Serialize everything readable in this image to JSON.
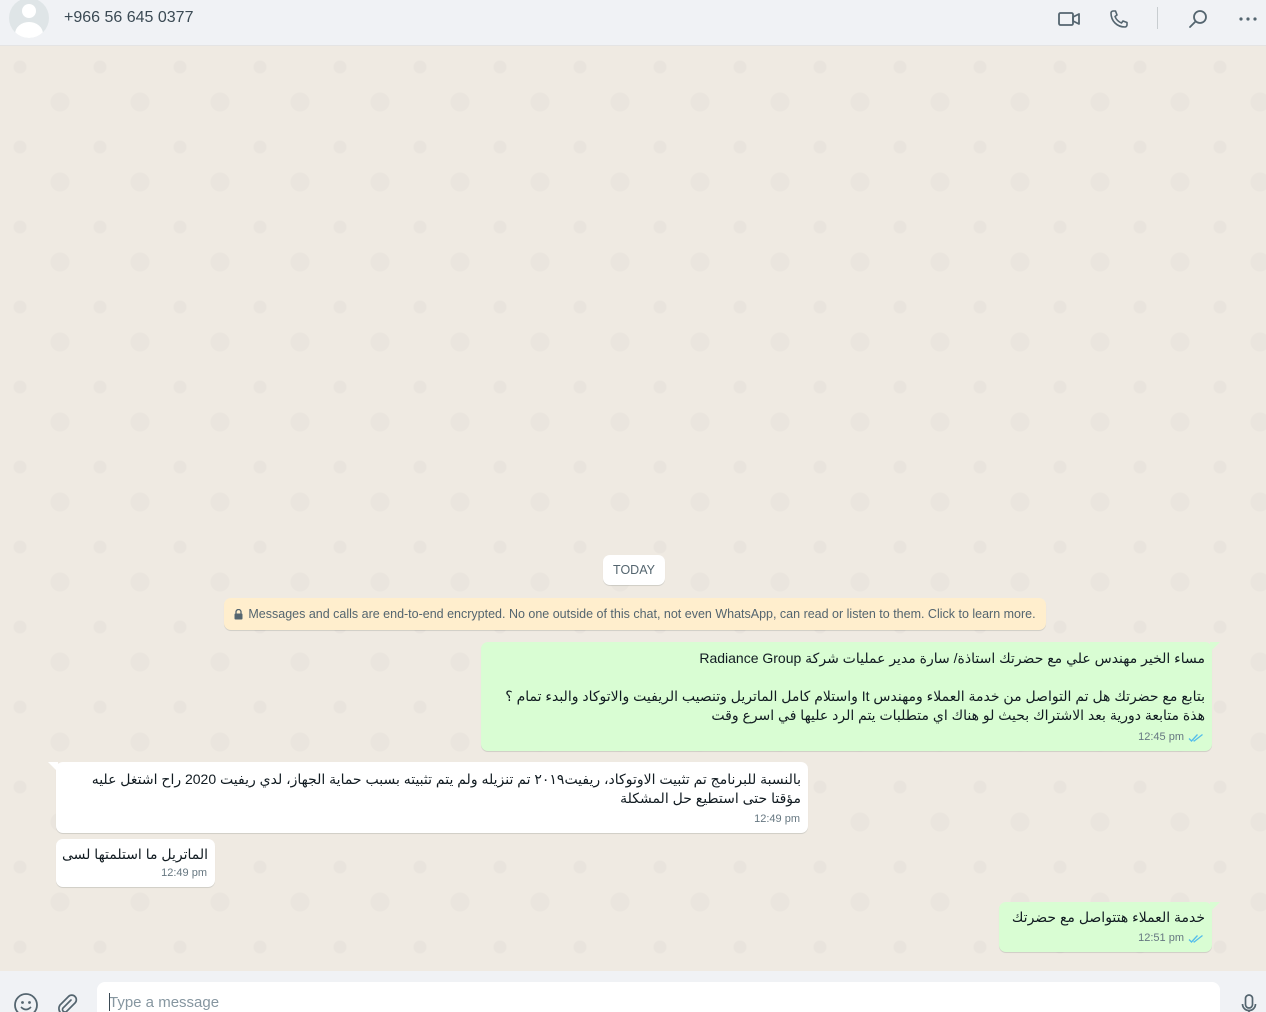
{
  "header": {
    "contact_name": "+966 56 645 0377",
    "icons": [
      "avatar",
      "video-call-icon",
      "voice-call-icon",
      "search-icon",
      "more-menu-icon"
    ]
  },
  "chat": {
    "date_label": "TODAY",
    "encryption_notice": "Messages and calls are end-to-end encrypted. No one outside of this chat, not even WhatsApp, can read or listen to them. Click to learn more.",
    "messages": [
      {
        "direction": "outgoing",
        "lines": [
          "مساء الخير مهندس علي مع حضرتك استاذة/ سارة مدير عمليات شركة Radiance Group",
          "",
          "بتابع مع حضرتك هل تم التواصل من خدمة العملاء ومهندس It واستلام كامل الماتريل وتنصيب الريفيت والاتوكاد والبدء تمام ؟",
          "هذة متابعة دورية بعد الاشتراك بحيث لو هناك اي متطلبات يتم الرد عليها في اسرع وقت"
        ],
        "time": "12:45 pm",
        "status": "read"
      },
      {
        "direction": "incoming",
        "lines": [
          "بالنسبة للبرنامج تم تثبيت الاوتوكاد، ريفيت٢٠١٩ تم تنزيله ولم يتم تثبيته بسبب حماية الجهاز، لدي ريفيت 2020 راح اشتغل عليه",
          "مؤقتا حتى استطيع حل المشكلة"
        ],
        "time": "12:49 pm"
      },
      {
        "direction": "incoming",
        "lines": [
          "الماتريل ما استلمتها لسى"
        ],
        "time": "12:49 pm"
      },
      {
        "direction": "outgoing",
        "lines": [
          "خدمة العملاء هتتواصل مع حضرتك"
        ],
        "time": "12:51 pm",
        "status": "read"
      }
    ]
  },
  "composer": {
    "placeholder": "Type a message",
    "icons": [
      "emoji-icon",
      "attach-icon",
      "microphone-icon"
    ]
  },
  "colors": {
    "outgoing_bubble": "#d9fdd3",
    "incoming_bubble": "#ffffff",
    "read_ticks": "#53bdeb",
    "chat_background": "#efeae2",
    "encryption_banner": "#ffeecd"
  }
}
